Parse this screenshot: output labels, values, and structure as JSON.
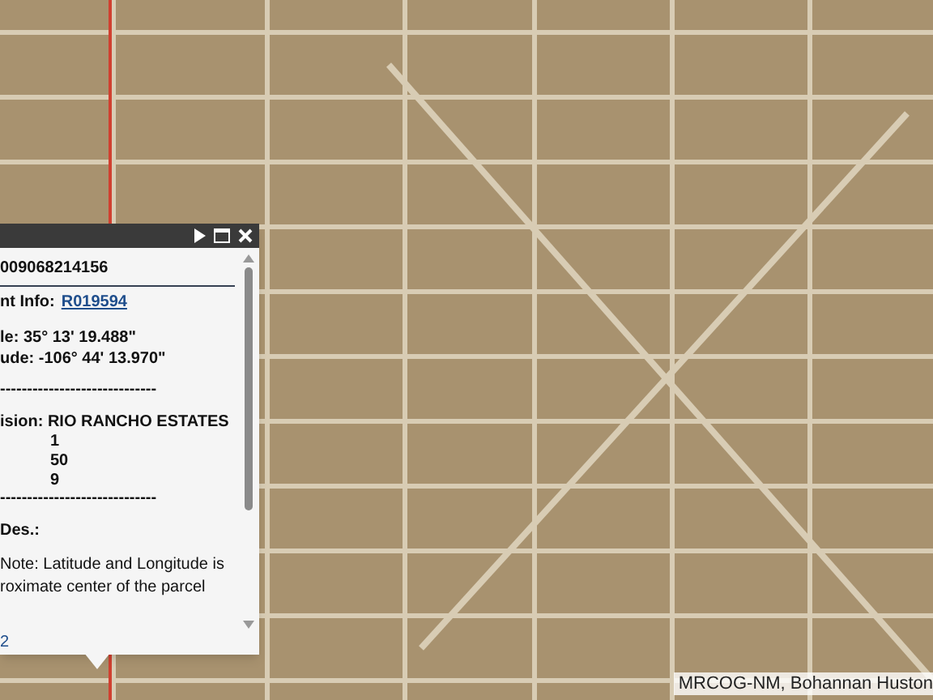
{
  "popup": {
    "lines": [
      {
        "kind": "heading",
        "text": "009068214156"
      },
      {
        "kind": "rule"
      },
      {
        "kind": "link_line",
        "text": "nt Info: ",
        "link": "R019594"
      },
      {
        "kind": "gap"
      },
      {
        "kind": "bold",
        "text": "le: 35° 13' 19.488\""
      },
      {
        "kind": "bold",
        "text": "ude: -106° 44' 13.970\""
      },
      {
        "kind": "gap"
      },
      {
        "kind": "dashes",
        "text": "-----------------------------"
      },
      {
        "kind": "gap"
      },
      {
        "kind": "bold",
        "text": "ision: RIO RANCHO ESTATES"
      },
      {
        "kind": "value",
        "text": "1"
      },
      {
        "kind": "value",
        "text": "50"
      },
      {
        "kind": "value",
        "text": "9"
      },
      {
        "kind": "dashes",
        "text": "-----------------------------"
      },
      {
        "kind": "gap"
      },
      {
        "kind": "bold",
        "text": "Des.:"
      },
      {
        "kind": "gap"
      },
      {
        "kind": "plain",
        "text": "Note: Latitude and Longitude is"
      },
      {
        "kind": "plain",
        "text": "roximate center of the parcel"
      }
    ],
    "footer_link": "2"
  },
  "attribution": "MRCOG-NM, Bohannan Huston"
}
